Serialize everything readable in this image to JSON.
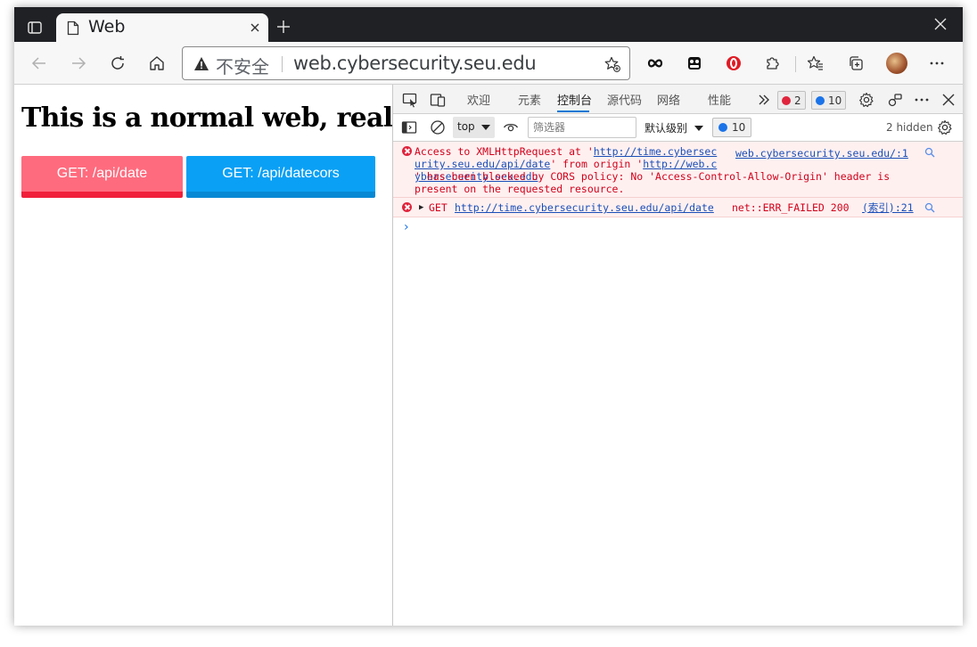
{
  "tab": {
    "title": "Web"
  },
  "omnibox": {
    "security_label": "不安全",
    "url": "web.cybersecurity.seu.edu"
  },
  "page": {
    "heading": "This is a normal web, really.",
    "btn_date": "GET: /api/date",
    "btn_datecors": "GET: /api/datecors"
  },
  "devtools": {
    "tabs": [
      "欢迎",
      "元素",
      "控制台",
      "源代码",
      "网络",
      "性能"
    ],
    "active_tab": "控制台",
    "error_count": "2",
    "info_count": "10",
    "context": "top",
    "filter_placeholder": "筛选器",
    "level": "默认级别",
    "message_count": "10",
    "hidden": "2 hidden"
  },
  "console": {
    "error1": {
      "prefix": "Access to XMLHttpRequest at '",
      "link1a": "http://time.cybersec",
      "link1b": "urity.seu.edu/api/date",
      "mid": "' from origin '",
      "link2a": "http://web.c",
      "link2b": "ybersecurity.seu.edu",
      "rest": "' has been blocked by CORS policy: No 'Access-Control-Allow-Origin' header is present on the requested resource.",
      "source": "web.cybersecurity.seu.edu/:1"
    },
    "error2": {
      "method": "GET",
      "url": "http://time.cybersecurity.seu.edu/api/date",
      "status": "net::ERR_FAILED 200",
      "source": "(索引):21"
    },
    "prompt": "›"
  },
  "colors": {
    "btn_red": "#ff6b7e",
    "btn_blue": "#0aa0f5",
    "accent": "#0078d4",
    "error": "#d0021b"
  }
}
